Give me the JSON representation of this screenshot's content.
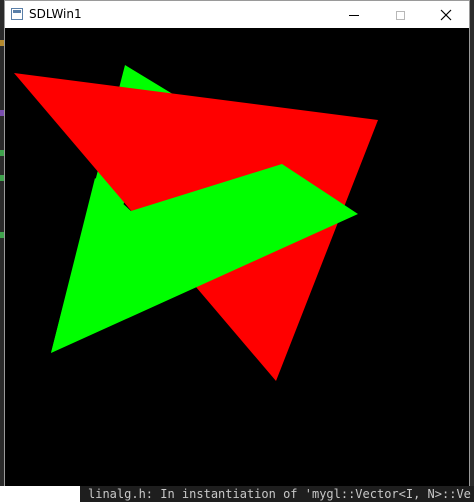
{
  "window": {
    "title": "SDLWin1",
    "controls": {
      "minimize": "minimize-icon",
      "maximize": "maximize-icon",
      "close": "close-icon"
    }
  },
  "canvas": {
    "background": "#000000",
    "shapes": [
      {
        "name": "green-triangle",
        "color": "#00ff00"
      },
      {
        "name": "red-triangle",
        "color": "#ff0000"
      },
      {
        "name": "green-quad",
        "color": "#00ff00"
      }
    ]
  },
  "background_terminal": {
    "text": "linalg.h: In instantiation of 'mygl::Vector<I, N>::Ve"
  },
  "colors": {
    "titlebar": "#ffffff",
    "red": "#ff0000",
    "green": "#00ff00"
  }
}
